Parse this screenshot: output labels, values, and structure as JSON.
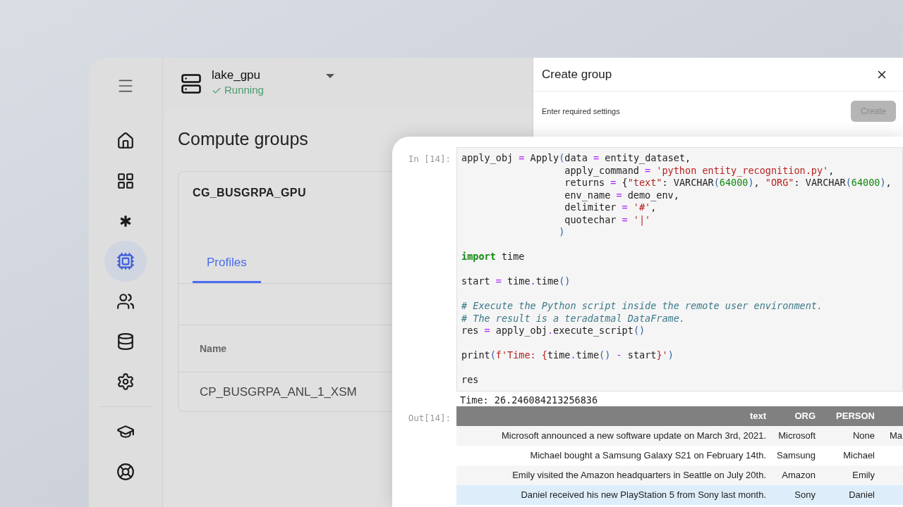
{
  "app": {
    "nav_items": [
      {
        "kind": "home",
        "selected": false
      },
      {
        "kind": "dashboard",
        "selected": false
      },
      {
        "kind": "asterisk",
        "selected": false
      },
      {
        "kind": "chip",
        "selected": true
      },
      {
        "kind": "users",
        "selected": false
      },
      {
        "kind": "data-import",
        "selected": false
      },
      {
        "kind": "settings",
        "selected": false
      },
      {
        "kind": "learn",
        "selected": false
      },
      {
        "kind": "support",
        "selected": false
      }
    ],
    "server": {
      "name": "lake_gpu",
      "status": "Running"
    },
    "page_title": "Compute groups",
    "card": {
      "title": "CG_BUSGRPA_GPU",
      "tabs": [
        {
          "label": "Profiles",
          "selected": true
        }
      ],
      "columns": [
        "Name"
      ],
      "rows": [
        [
          "CP_BUSGRPA_ANL_1_XSM"
        ]
      ]
    }
  },
  "create_panel": {
    "title": "Create group",
    "hint": "Enter required settings",
    "button": {
      "label": "Create",
      "disabled": true
    }
  },
  "notebook": {
    "in_prompt": "In [14]:",
    "code_blocks": [
      [
        [
          {
            "text": "apply_obj ",
            "kind": "plain"
          },
          {
            "text": "=",
            "kind": "op"
          },
          {
            "text": " Apply",
            "kind": "plain"
          },
          {
            "text": "(",
            "kind": "paren"
          },
          {
            "text": "data ",
            "kind": "plain"
          },
          {
            "text": "=",
            "kind": "op"
          },
          {
            "text": " entity_dataset,",
            "kind": "plain"
          }
        ],
        [
          {
            "text": "                  apply_command ",
            "kind": "plain"
          },
          {
            "text": "=",
            "kind": "op"
          },
          {
            "text": " 'python entity_recognition.py'",
            "kind": "str"
          },
          {
            "text": ",",
            "kind": "plain"
          }
        ],
        [
          {
            "text": "                  returns ",
            "kind": "plain"
          },
          {
            "text": "=",
            "kind": "op"
          },
          {
            "text": " {",
            "kind": "plain"
          },
          {
            "text": "\"text\"",
            "kind": "str"
          },
          {
            "text": ": VARCHAR",
            "kind": "plain"
          },
          {
            "text": "(",
            "kind": "paren"
          },
          {
            "text": "64000",
            "kind": "num"
          },
          {
            "text": ")",
            "kind": "paren"
          },
          {
            "text": ", ",
            "kind": "plain"
          },
          {
            "text": "\"ORG\"",
            "kind": "str"
          },
          {
            "text": ": VARCHAR",
            "kind": "plain"
          },
          {
            "text": "(",
            "kind": "paren"
          },
          {
            "text": "64000",
            "kind": "num"
          },
          {
            "text": ")",
            "kind": "paren"
          },
          {
            "text": ",",
            "kind": "plain"
          }
        ],
        [
          {
            "text": "                  env_name ",
            "kind": "plain"
          },
          {
            "text": "=",
            "kind": "op"
          },
          {
            "text": " demo_env,",
            "kind": "plain"
          }
        ],
        [
          {
            "text": "                  delimiter ",
            "kind": "plain"
          },
          {
            "text": "=",
            "kind": "op"
          },
          {
            "text": " '#'",
            "kind": "str"
          },
          {
            "text": ",",
            "kind": "plain"
          }
        ],
        [
          {
            "text": "                  quotechar ",
            "kind": "plain"
          },
          {
            "text": "=",
            "kind": "op"
          },
          {
            "text": " '|'",
            "kind": "str"
          }
        ],
        [
          {
            "text": "                 )",
            "kind": "paren"
          }
        ]
      ],
      [
        [
          {
            "text": "import",
            "kind": "kw"
          },
          {
            "text": " time",
            "kind": "plain"
          }
        ]
      ],
      [
        [
          {
            "text": "start ",
            "kind": "plain"
          },
          {
            "text": "=",
            "kind": "op"
          },
          {
            "text": " time",
            "kind": "plain"
          },
          {
            "text": ".",
            "kind": "op"
          },
          {
            "text": "time",
            "kind": "plain"
          },
          {
            "text": "()",
            "kind": "paren"
          }
        ]
      ],
      [
        [
          {
            "text": "# Execute the Python script inside the remote user environment.",
            "kind": "comment"
          }
        ],
        [
          {
            "text": "# The result is a teradatmal DataFrame.",
            "kind": "comment"
          }
        ],
        [
          {
            "text": "res ",
            "kind": "plain"
          },
          {
            "text": "=",
            "kind": "op"
          },
          {
            "text": " apply_obj",
            "kind": "plain"
          },
          {
            "text": ".",
            "kind": "op"
          },
          {
            "text": "execute_script",
            "kind": "plain"
          },
          {
            "text": "()",
            "kind": "paren"
          }
        ]
      ],
      [
        [
          {
            "text": "print",
            "kind": "plain"
          },
          {
            "text": "(",
            "kind": "paren"
          },
          {
            "text": "f'Time: {",
            "kind": "str"
          },
          {
            "text": "time",
            "kind": "plain"
          },
          {
            "text": ".",
            "kind": "op"
          },
          {
            "text": "time",
            "kind": "plain"
          },
          {
            "text": "()",
            "kind": "paren"
          },
          {
            "text": " - ",
            "kind": "op"
          },
          {
            "text": "start",
            "kind": "plain"
          },
          {
            "text": "}'",
            "kind": "str"
          },
          {
            "text": ")",
            "kind": "paren"
          }
        ]
      ],
      [
        [
          {
            "text": "res",
            "kind": "plain"
          }
        ]
      ]
    ],
    "stdout": "Time: 26.246084213256836",
    "out_prompt": "Out[14]:",
    "table": {
      "columns": [
        "text",
        "ORG",
        "PERSON"
      ],
      "rows": [
        {
          "cells": [
            "Microsoft announced a new software update on March 3rd, 2021.",
            "Microsoft",
            "None",
            "Ma"
          ],
          "highlighted": false
        },
        {
          "cells": [
            "Michael bought a Samsung Galaxy S21 on February 14th.",
            "Samsung",
            "Michael"
          ],
          "highlighted": false
        },
        {
          "cells": [
            "Emily visited the Amazon headquarters in Seattle on July 20th.",
            "Amazon",
            "Emily"
          ],
          "highlighted": false
        },
        {
          "cells": [
            "Daniel received his new PlayStation 5 from Sony last month.",
            "Sony",
            "Daniel"
          ],
          "highlighted": true
        }
      ]
    }
  }
}
